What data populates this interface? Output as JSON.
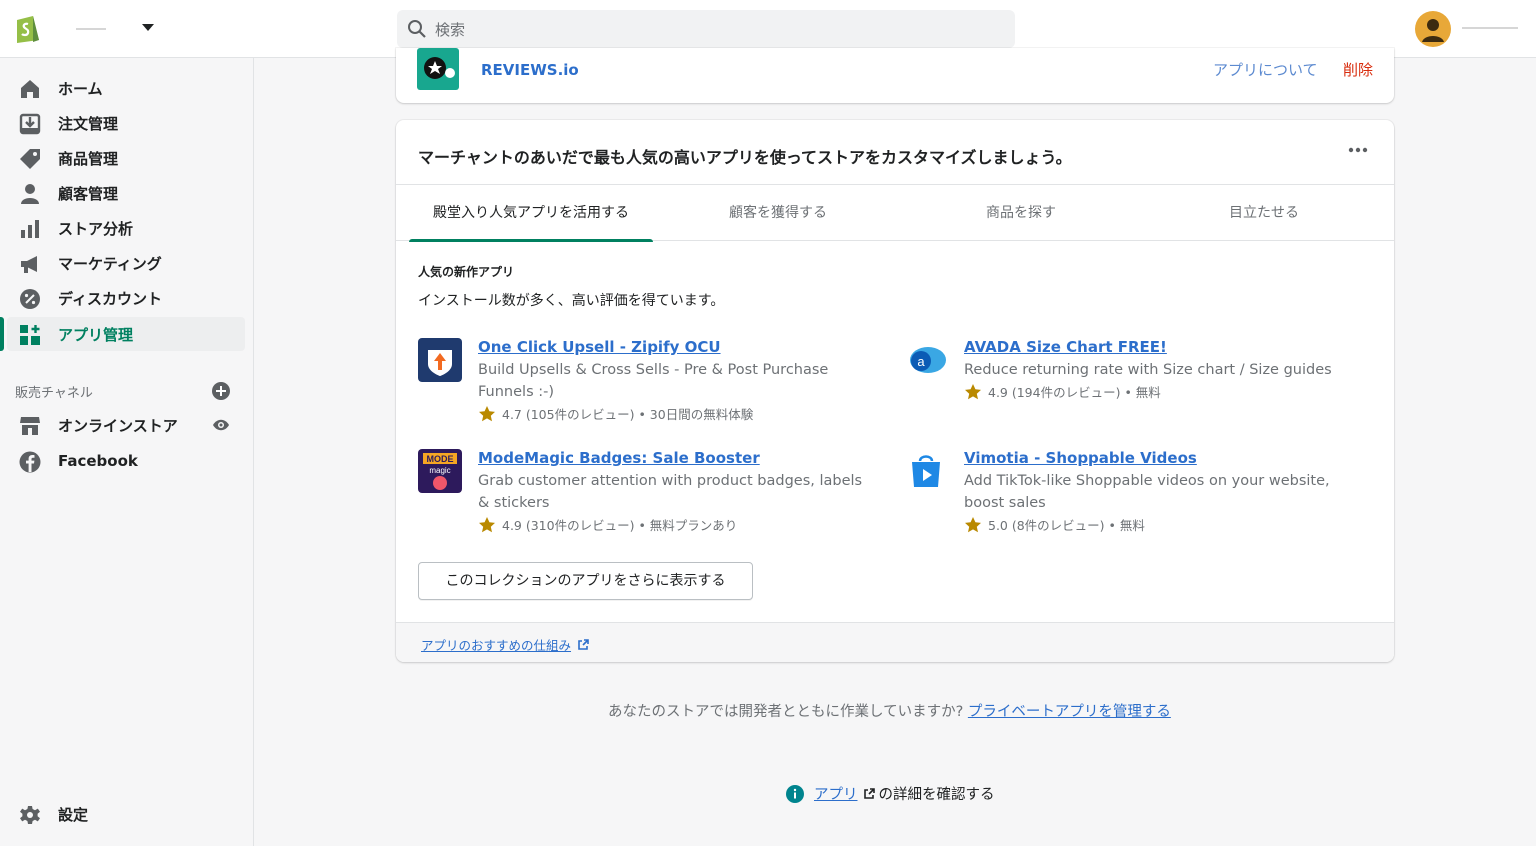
{
  "topbar": {
    "search_placeholder": "検索"
  },
  "sidebar": {
    "items": [
      {
        "label": "ホーム",
        "icon": "home-icon"
      },
      {
        "label": "注文管理",
        "icon": "orders-icon"
      },
      {
        "label": "商品管理",
        "icon": "tag-icon"
      },
      {
        "label": "顧客管理",
        "icon": "person-icon"
      },
      {
        "label": "ストア分析",
        "icon": "analytics-icon"
      },
      {
        "label": "マーケティング",
        "icon": "megaphone-icon"
      },
      {
        "label": "ディスカウント",
        "icon": "discount-icon"
      },
      {
        "label": "アプリ管理",
        "icon": "apps-icon",
        "active": true
      }
    ],
    "channels_label": "販売チャネル",
    "channels": [
      {
        "label": "オンラインストア",
        "icon": "store-icon"
      },
      {
        "label": "Facebook",
        "icon": "facebook-icon"
      }
    ],
    "settings_label": "設定"
  },
  "installed_app": {
    "name": "REVIEWS.io",
    "about_label": "アプリについて",
    "delete_label": "削除"
  },
  "recommend": {
    "title": "マーチャントのあいだで最も人気の高いアプリを使ってストアをカスタマイズしましょう。",
    "tabs": [
      "殿堂入り人気アプリを活用する",
      "顧客を獲得する",
      "商品を探す",
      "目立たせる"
    ],
    "section_title": "人気の新作アプリ",
    "section_desc": "インストール数が多く、高い評価を得ています。",
    "apps": [
      {
        "name": "One Click Upsell - Zipify OCU",
        "desc": "Build Upsells & Cross Sells - Pre & Post Purchase Funnels :-)",
        "rating": "4.7 (105件のレビュー) • 30日間の無料体験"
      },
      {
        "name": "AVADA Size Chart FREE!",
        "desc": "Reduce returning rate with Size chart / Size guides",
        "rating": "4.9 (194件のレビュー) • 無料"
      },
      {
        "name": "ModeMagic Badges: Sale Booster",
        "desc": "Grab customer attention with product badges, labels & stickers",
        "rating": "4.9 (310件のレビュー) • 無料プランあり"
      },
      {
        "name": "Vimotia - Shoppable Videos",
        "desc": "Add TikTok-like Shoppable videos on your website, boost sales",
        "rating": "5.0 (8件のレビュー) • 無料"
      }
    ],
    "more_button": "このコレクションのアプリをさらに表示する",
    "footer_link": "アプリのおすすめの仕組み"
  },
  "private_apps": {
    "text": "あなたのストアでは開発者とともに作業していますか?",
    "link": "プライベートアプリを管理する"
  },
  "info": {
    "link": "アプリ",
    "text": "の詳細を確認する"
  },
  "colors": {
    "accent": "#008060",
    "link": "#2c6ecb",
    "danger": "#d82c0d",
    "star": "#b98900"
  }
}
